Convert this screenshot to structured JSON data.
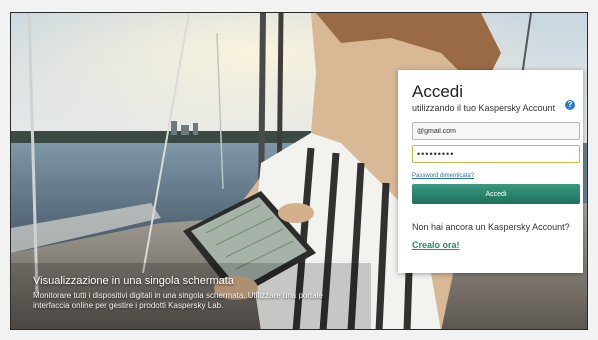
{
  "caption": {
    "title": "Visualizzazione in una singola schermata",
    "body": "Monitorare tutti i dispositivi digitali in una singola schermata. Utilizzare una portale interfaccia online per gestire i prodotti Kaspersky Lab."
  },
  "login": {
    "title": "Accedi",
    "subtitle": "utilizzando il tuo Kaspersky Account",
    "help_icon": "?",
    "email_value": "@gmail.com",
    "password_value": "•••••••••",
    "forgot_link": "Password dimenticata?",
    "submit_label": "Accedi",
    "no_account_text": "Non hai ancora un Kaspersky Account?",
    "create_link": "Crealo ora!"
  },
  "colors": {
    "accent_green": "#1f6f5c",
    "link_blue": "#2c6fb0",
    "focus_border": "#d3b34a"
  }
}
